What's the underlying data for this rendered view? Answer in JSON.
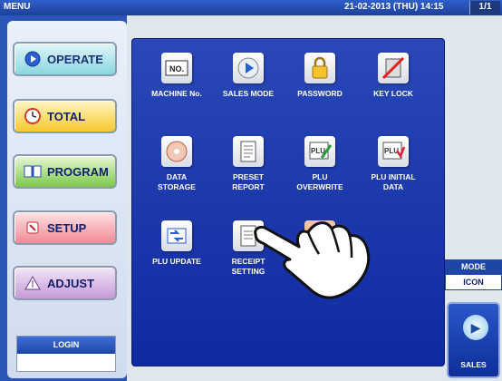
{
  "titlebar": {
    "menu": "MENU",
    "datetime": "21-02-2013 (THU) 14:15",
    "page": "1/1"
  },
  "left_menu": {
    "operate": "OPERATE",
    "total": "TOTAL",
    "program": "PROGRAM",
    "setup": "SETUP",
    "adjust": "ADJUST",
    "login": "LOGIN"
  },
  "icons": [
    {
      "label": "MACHINE No.",
      "icon": "machine-no-icon"
    },
    {
      "label": "SALES MODE",
      "icon": "sales-mode-icon"
    },
    {
      "label": "PASSWORD",
      "icon": "lock-icon"
    },
    {
      "label": "KEY LOCK",
      "icon": "keypad-no-icon"
    },
    {
      "label": "DATA\nSTORAGE",
      "icon": "disc-icon"
    },
    {
      "label": "PRESET\nREPORT",
      "icon": "document-icon"
    },
    {
      "label": "PLU\nOVERWRITE",
      "icon": "plu-edit-icon"
    },
    {
      "label": "PLU INITIAL\nDATA",
      "icon": "plu-initial-icon"
    },
    {
      "label": "PLU UPDATE",
      "icon": "plu-update-icon"
    },
    {
      "label": "RECEIPT\nSETTING",
      "icon": "receipt-icon"
    }
  ],
  "mode": {
    "label": "MODE",
    "value": "ICON"
  },
  "sales_button": {
    "label": "SALES"
  }
}
